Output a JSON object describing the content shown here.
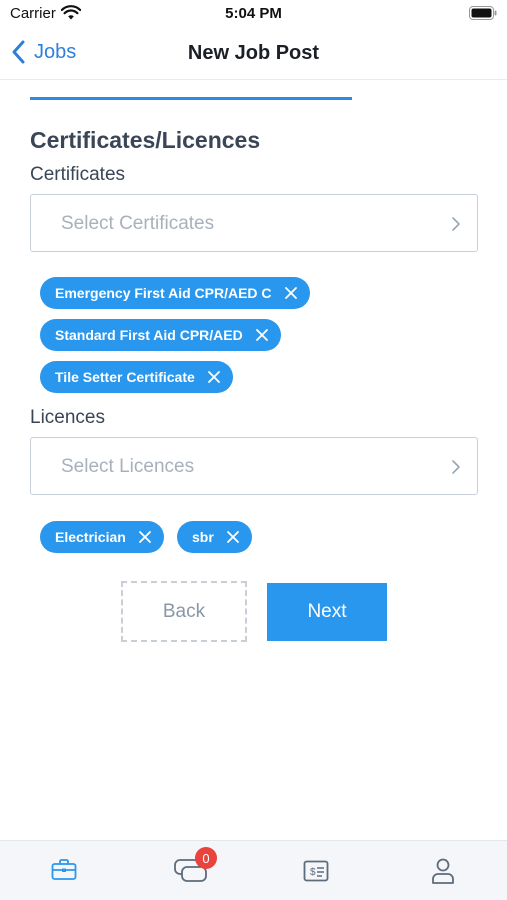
{
  "status_bar": {
    "carrier": "Carrier",
    "time": "5:04 PM"
  },
  "nav": {
    "back_label": "Jobs",
    "title": "New Job Post"
  },
  "progress": {
    "fraction": 0.4
  },
  "section": {
    "heading": "Certificates/Licences"
  },
  "certificates": {
    "label": "Certificates",
    "placeholder": "Select Certificates",
    "selected": [
      "Emergency First Aid CPR/AED C",
      "Standard First Aid CPR/AED",
      "Tile Setter Certificate"
    ]
  },
  "licences": {
    "label": "Licences",
    "placeholder": "Select Licences",
    "selected": [
      "Electrician",
      "sbr"
    ]
  },
  "buttons": {
    "back": "Back",
    "next": "Next"
  },
  "tab_bar": {
    "tabs": [
      {
        "icon": "briefcase-icon",
        "active": true
      },
      {
        "icon": "chat-bubbles-icon",
        "badge": "0"
      },
      {
        "icon": "invoice-icon"
      },
      {
        "icon": "profile-icon"
      }
    ]
  },
  "colors": {
    "accent": "#2a97ee",
    "link": "#2e7fd9",
    "badge": "#e8433c",
    "heading": "#3a4656"
  }
}
